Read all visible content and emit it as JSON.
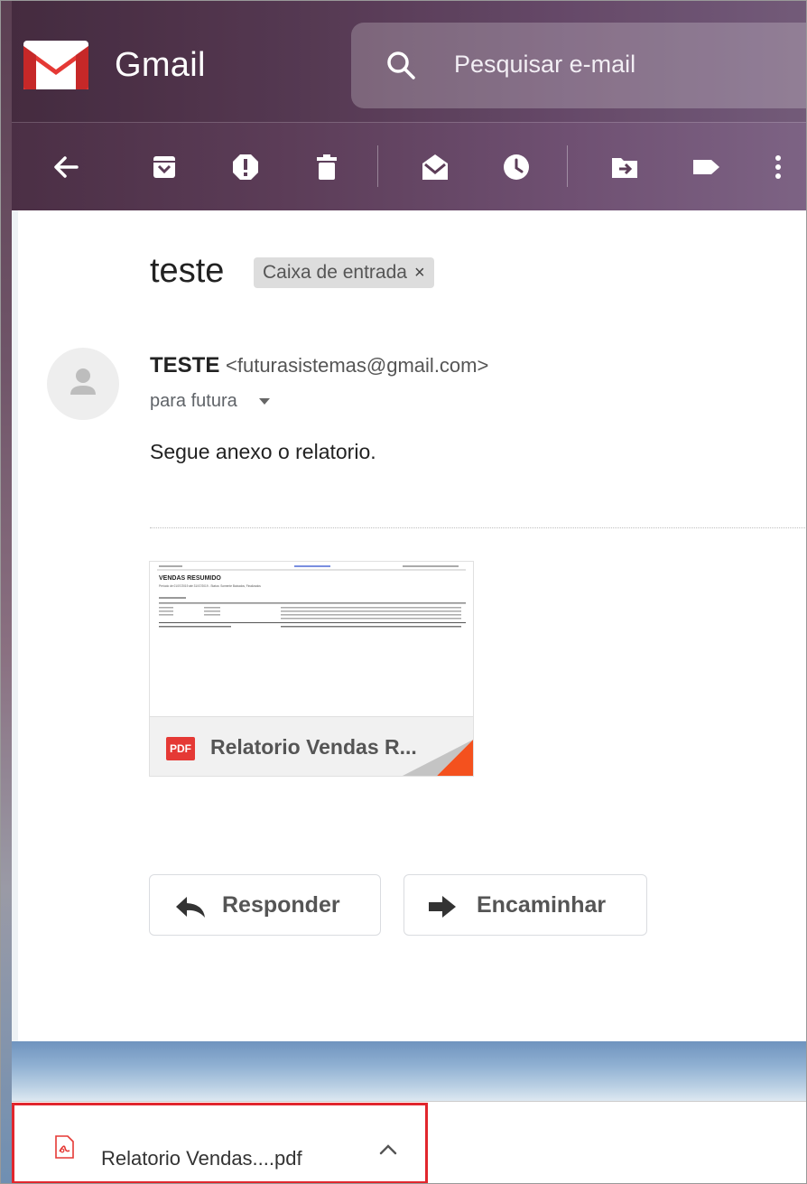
{
  "header": {
    "brand": "Gmail",
    "search_placeholder": "Pesquisar e-mail"
  },
  "toolbar": {
    "icons": [
      "back-arrow-icon",
      "archive-icon",
      "report-spam-icon",
      "delete-icon",
      "mark-unread-icon",
      "snooze-icon",
      "move-to-icon",
      "label-icon",
      "more-options-icon"
    ]
  },
  "email": {
    "subject": "teste",
    "label_chip": "Caixa de entrada",
    "label_close": "×",
    "sender_name": "TESTE",
    "sender_email": "<futurasistemas@gmail.com>",
    "to": "para futura",
    "body": "Segue anexo o relatorio."
  },
  "attachment": {
    "badge": "PDF",
    "filename": "Relatorio Vendas R...",
    "preview": {
      "heading": "VENDAS RESUMIDO",
      "subheading": "Período de 01/07/2019 até 31/07/2019 - Status: Somente Baixados, Finalizados"
    }
  },
  "actions": {
    "reply": "Responder",
    "forward": "Encaminhar"
  },
  "download_bar": {
    "filename": "Relatorio  Vendas....pdf"
  },
  "colors": {
    "gmail_red": "#e53935",
    "highlight_box": "#e1262d"
  }
}
